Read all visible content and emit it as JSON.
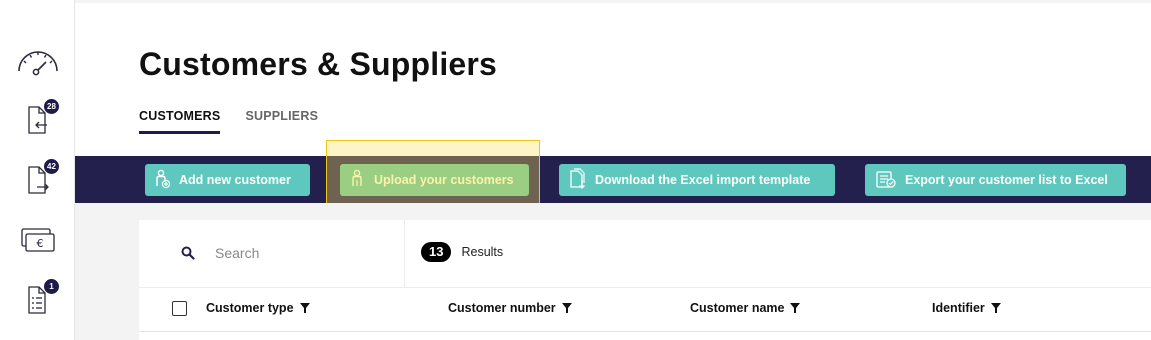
{
  "sidebar": {
    "items": [
      {
        "name": "dashboard",
        "icon": "speedometer-icon",
        "badge": ""
      },
      {
        "name": "incoming-documents",
        "icon": "document-incoming-icon",
        "badge": "28"
      },
      {
        "name": "outgoing-documents",
        "icon": "document-outgoing-icon",
        "badge": "42"
      },
      {
        "name": "payments",
        "icon": "euro-card-icon",
        "badge": ""
      },
      {
        "name": "tasks",
        "icon": "checklist-icon",
        "badge": "1"
      }
    ]
  },
  "header": {
    "title": "Customers & Suppliers"
  },
  "tabs": [
    {
      "label": "CUSTOMERS",
      "active": true
    },
    {
      "label": "SUPPLIERS",
      "active": false
    }
  ],
  "toolbar": {
    "add_label": "Add new customer",
    "upload_label": "Upload your customers",
    "download_label": "Download the Excel import template",
    "export_label": "Export your customer list to Excel"
  },
  "search": {
    "placeholder": "Search"
  },
  "results": {
    "count": "13",
    "label": "Results"
  },
  "table": {
    "columns": [
      "Customer type",
      "Customer number",
      "Customer name",
      "Identifier"
    ]
  },
  "colors": {
    "toolbar_bg": "#24204e",
    "button_teal": "#5ec8bf",
    "button_highlight": "#68c49a",
    "highlight_box": "#f0c419",
    "badge_bg": "#1f1b4a"
  }
}
